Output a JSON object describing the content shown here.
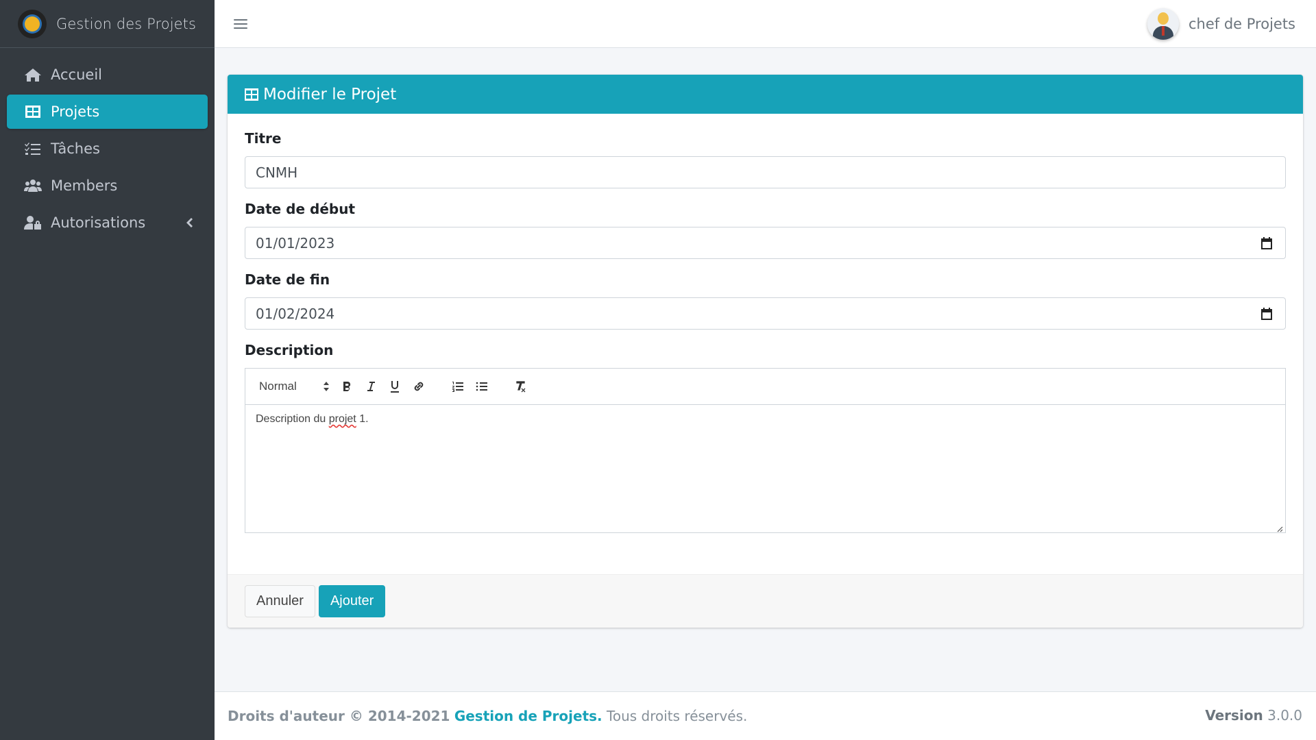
{
  "brand": {
    "title": "Gestion des Projets"
  },
  "sidebar": {
    "items": [
      {
        "label": "Accueil",
        "icon": "home-icon"
      },
      {
        "label": "Projets",
        "icon": "table-icon",
        "active": true
      },
      {
        "label": "Tâches",
        "icon": "tasks-icon"
      },
      {
        "label": "Members",
        "icon": "users-icon"
      },
      {
        "label": "Autorisations",
        "icon": "user-lock-icon"
      }
    ]
  },
  "header": {
    "user_name": "chef de Projets"
  },
  "card": {
    "title": "Modifier le Projet",
    "fields": {
      "titre": {
        "label": "Titre",
        "value": "CNMH"
      },
      "date_debut": {
        "label": "Date de début",
        "value": "01/01/2023"
      },
      "date_fin": {
        "label": "Date de fin",
        "value": "01/02/2024"
      },
      "description": {
        "label": "Description",
        "format": "Normal",
        "text_before": "Description du ",
        "text_misspelled": "projet",
        "text_after": " 1."
      }
    },
    "buttons": {
      "cancel": "Annuler",
      "submit": "Ajouter"
    }
  },
  "footer": {
    "copyright": "Droits d'auteur © 2014-2021",
    "brand_link": "Gestion de Projets.",
    "rights": "Tous droits réservés.",
    "version_label": "Version",
    "version_value": "3.0.0"
  },
  "colors": {
    "accent": "#17a2b8",
    "sidebar_bg": "#343a40",
    "page_bg": "#f4f6f9"
  }
}
